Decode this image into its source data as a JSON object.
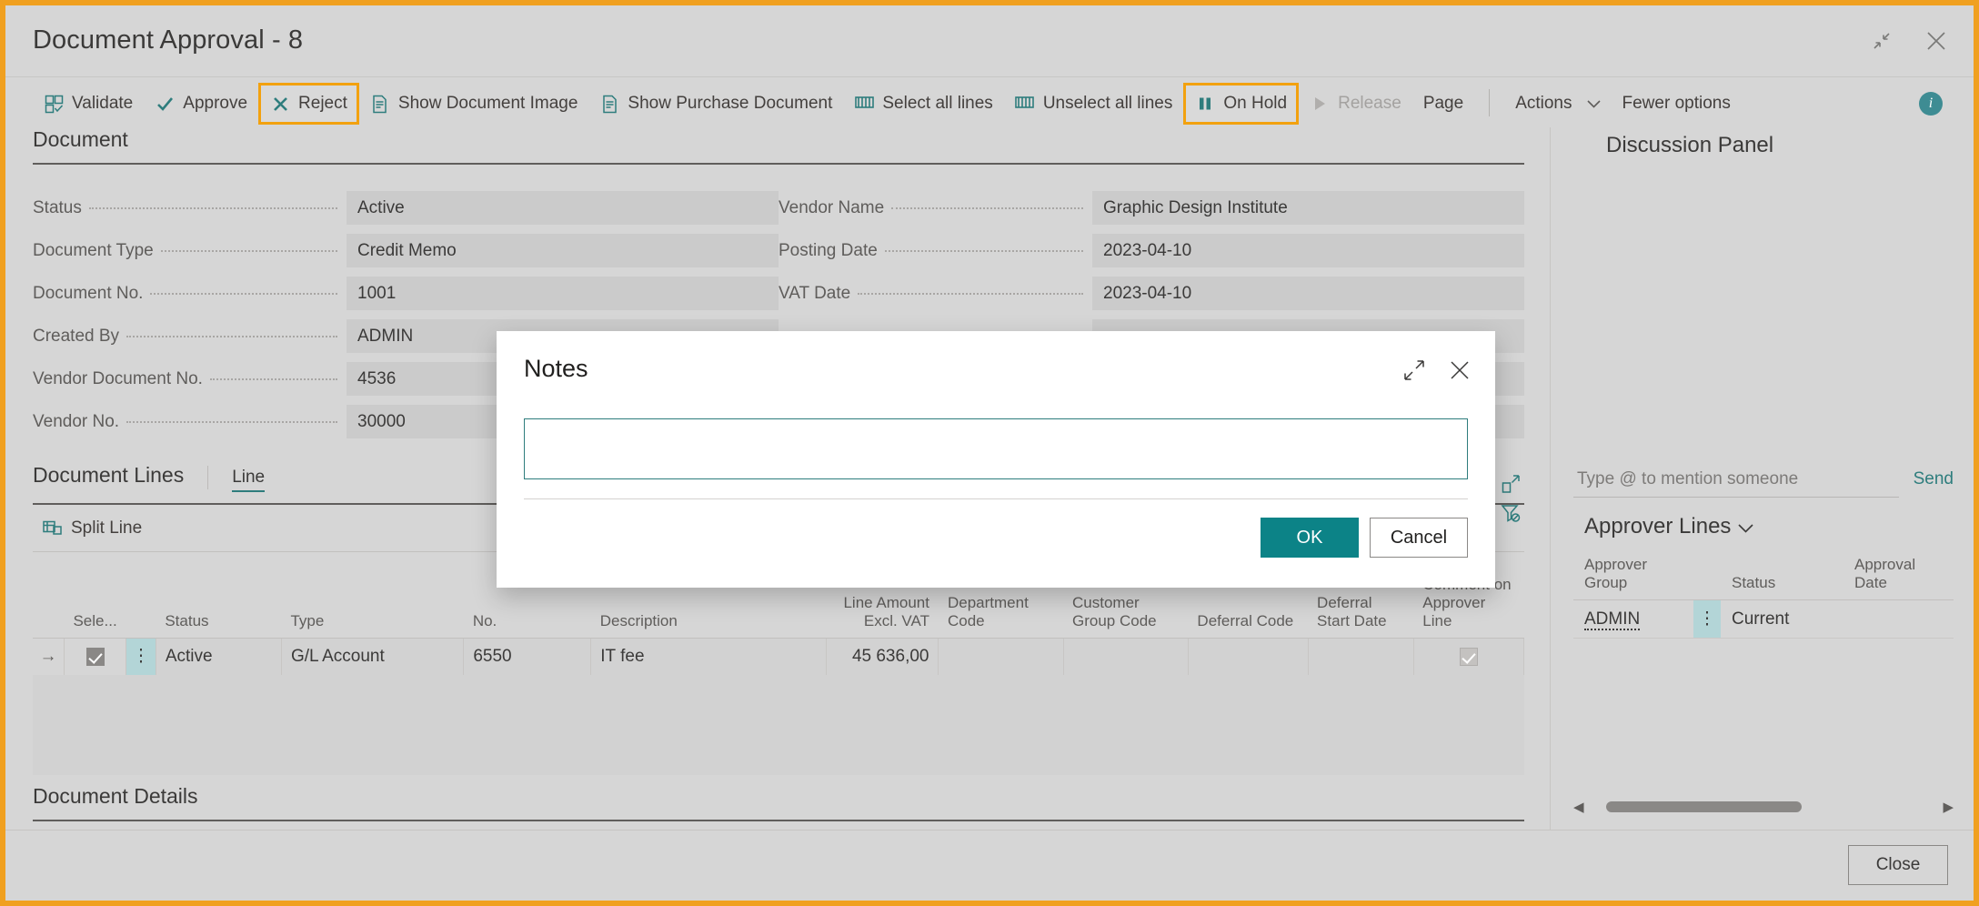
{
  "window": {
    "title": "Document Approval - 8",
    "restore_icon": "restore-down-icon",
    "close_icon": "close-icon"
  },
  "toolbar": {
    "items": [
      {
        "label": "Validate",
        "icon": "validate-icon",
        "state": "normal"
      },
      {
        "label": "Approve",
        "icon": "check-icon",
        "state": "normal"
      },
      {
        "label": "Reject",
        "icon": "x-icon",
        "state": "highlighted"
      },
      {
        "label": "Show Document Image",
        "icon": "document-image-icon",
        "state": "normal"
      },
      {
        "label": "Show Purchase Document",
        "icon": "document-icon",
        "state": "normal"
      },
      {
        "label": "Select all lines",
        "icon": "select-lines-icon",
        "state": "normal"
      },
      {
        "label": "Unselect all lines",
        "icon": "unselect-lines-icon",
        "state": "normal"
      },
      {
        "label": "On Hold",
        "icon": "pause-icon",
        "state": "highlighted"
      },
      {
        "label": "Release",
        "icon": "play-icon",
        "state": "disabled"
      },
      {
        "label": "Page",
        "icon": "",
        "state": "normal"
      }
    ],
    "actions_label": "Actions",
    "fewer_options_label": "Fewer options",
    "info_label": "i"
  },
  "document": {
    "section_title": "Document",
    "left_fields": [
      {
        "label": "Status",
        "value": "Active"
      },
      {
        "label": "Document Type",
        "value": "Credit Memo"
      },
      {
        "label": "Document No.",
        "value": "1001"
      },
      {
        "label": "Created By",
        "value": "ADMIN"
      },
      {
        "label": "Vendor Document No.",
        "value": "4536"
      },
      {
        "label": "Vendor No.",
        "value": "30000"
      }
    ],
    "right_fields": [
      {
        "label": "Vendor Name",
        "value": "Graphic Design Institute"
      },
      {
        "label": "Posting Date",
        "value": "2023-04-10"
      },
      {
        "label": "VAT Date",
        "value": "2023-04-10"
      },
      {
        "label": "",
        "value": ""
      },
      {
        "label": "",
        "value": ""
      },
      {
        "label": "",
        "value": ""
      }
    ]
  },
  "document_lines": {
    "section_title": "Document Lines",
    "tab_label": "Line",
    "split_line_label": "Split Line",
    "expand_icon": "expand-icon",
    "filter_icon": "clear-filter-icon",
    "columns": [
      "Sele...",
      "Status",
      "Type",
      "No.",
      "Description",
      "Line Amount Excl. VAT",
      "Department Code",
      "Customer Group Code",
      "Deferral Code",
      "Deferral Start Date",
      "Comment on Approver Line"
    ],
    "rows": [
      {
        "selected": true,
        "status": "Active",
        "type": "G/L Account",
        "no": "6550",
        "description": "IT fee",
        "line_amount_excl_vat": "45 636,00",
        "department_code": "",
        "customer_group_code": "",
        "deferral_code": "",
        "deferral_start_date": "",
        "comment_on_approver_line": true
      }
    ]
  },
  "document_details": {
    "section_title": "Document Details"
  },
  "discussion": {
    "title": "Discussion Panel",
    "input_placeholder": "Type @ to mention someone",
    "input_value": "",
    "send_label": "Send"
  },
  "approver_lines": {
    "title": "Approver Lines",
    "chevron_icon": "chevron-down-icon",
    "columns": [
      "Approver Group",
      "Status",
      "Approval Date"
    ],
    "rows": [
      {
        "approver_group": "ADMIN",
        "status": "Current",
        "approval_date": ""
      }
    ],
    "scroll_left_icon": "scroll-left-icon",
    "scroll_right_icon": "scroll-right-icon"
  },
  "footer": {
    "close_label": "Close"
  },
  "notes_dialog": {
    "title": "Notes",
    "expand_icon": "expand-diagonal-icon",
    "close_icon": "close-icon",
    "text_value": "",
    "ok_label": "OK",
    "cancel_label": "Cancel"
  },
  "colors": {
    "accent_teal": "#0c8387",
    "highlight_orange": "#f2a10f",
    "app_background": "#d6d6d6",
    "field_background": "#cbcbcb"
  }
}
